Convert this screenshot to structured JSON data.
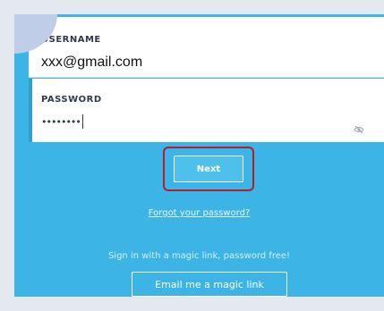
{
  "login": {
    "username_label": "USERNAME",
    "username_value": "xxx@gmail.com",
    "password_label": "PASSWORD",
    "password_value": "••••••••",
    "next_label": "Next",
    "forgot_label": "Forgot your password?",
    "magic_text": "Sign in with a magic link, password free!",
    "magic_button_label": "Email me a magic link"
  },
  "icons": {
    "password_toggle": "eye-slash-icon"
  },
  "colors": {
    "panel_background": "#3cb4e6",
    "page_background": "#e4e8ef",
    "highlight_outline": "#b01e2f",
    "field_accent": "#2f9fd0"
  }
}
